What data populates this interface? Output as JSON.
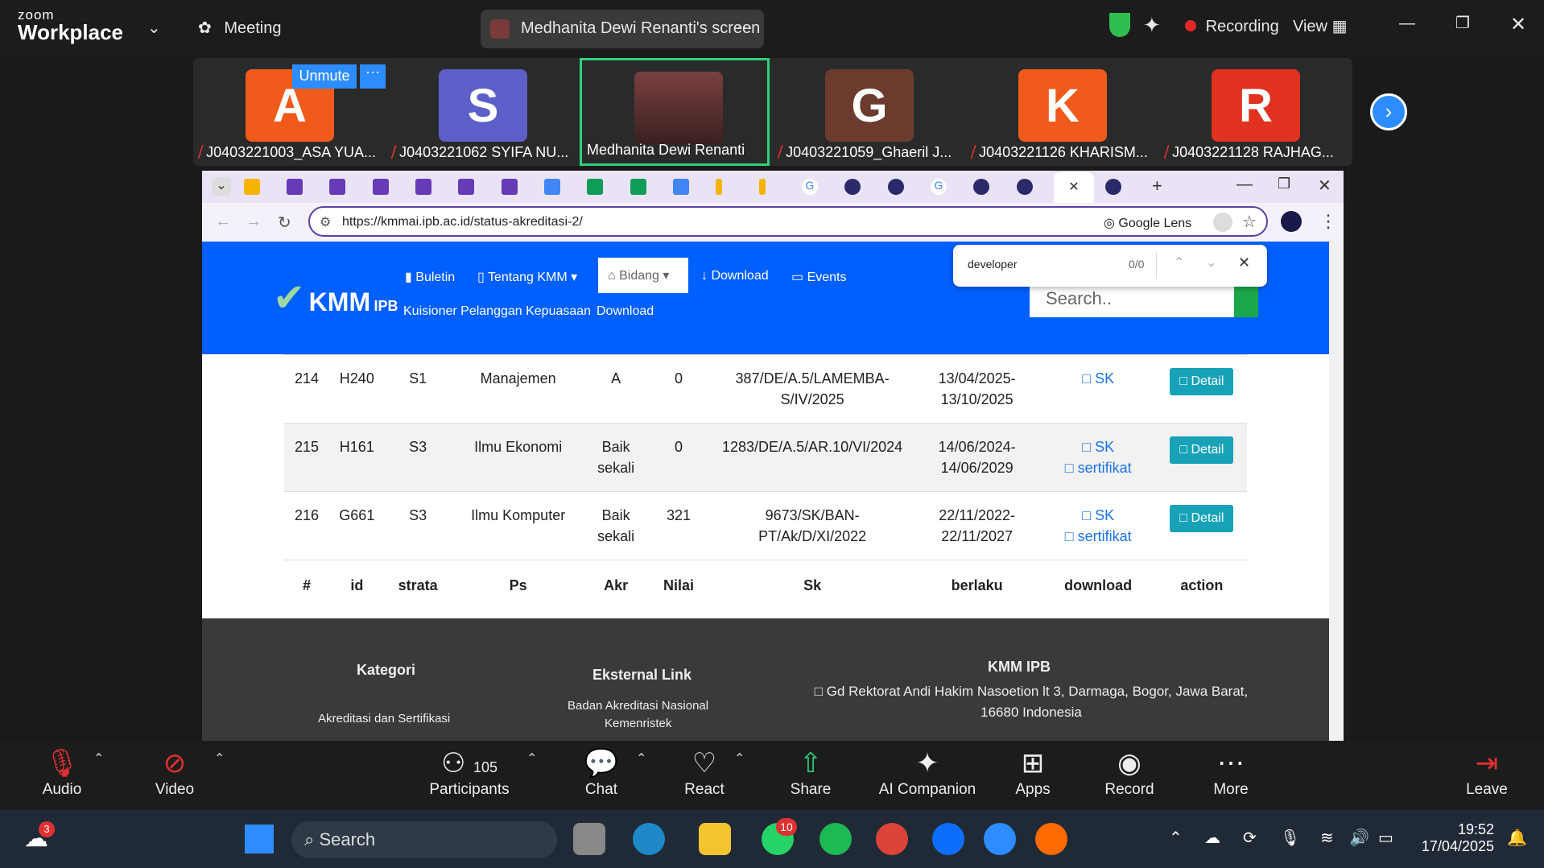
{
  "zoom": {
    "logo_small": "zoom",
    "logo_big": "Workplace",
    "meeting_label": "Meeting",
    "screen_share_label": "Medhanita Dewi Renanti's screen",
    "recording_label": "Recording",
    "view_label": "View",
    "unmute_label": "Unmute"
  },
  "participants": [
    {
      "initial": "A",
      "name": "J0403221003_ASA YUA...",
      "color": "#f05a1a"
    },
    {
      "initial": "S",
      "name": "J0403221062 SYIFA NU...",
      "color": "#5b5fc7"
    },
    {
      "initial": "",
      "name": "Medhanita Dewi Renanti",
      "color": "#6b3a3a"
    },
    {
      "initial": "G",
      "name": "J0403221059_Ghaeril J...",
      "color": "#6b3b2e"
    },
    {
      "initial": "K",
      "name": "J0403221126 KHARISM...",
      "color": "#f05a1a"
    },
    {
      "initial": "R",
      "name": "J0403221128 RAJHAG...",
      "color": "#e0321e"
    }
  ],
  "browser": {
    "url": "https://kmmai.ipb.ac.id/status-akreditasi-2/",
    "lens_label": "Google Lens",
    "find_query": "developer",
    "find_count": "0/0"
  },
  "site": {
    "logo_text": "KMM",
    "logo_sub": "IPB",
    "nav": [
      "Buletin",
      "Tentang KMM",
      "Bidang",
      "Download",
      "Events"
    ],
    "nav2": [
      "Kuisioner Pelanggan Kepuasaan",
      "Download"
    ],
    "search_placeholder": "Search.."
  },
  "table": {
    "headers": [
      "#",
      "id",
      "strata",
      "Ps",
      "Akr",
      "Nilai",
      "Sk",
      "berlaku",
      "download",
      "action"
    ],
    "rows": [
      {
        "no": "214",
        "id": "H240",
        "strata": "S1",
        "ps": "Manajemen",
        "akr": "A",
        "nilai": "0",
        "sk": "387/DE/A.5/LAMEMBA-S/IV/2025",
        "berlaku": "13/04/2025-13/10/2025",
        "dl1": "SK",
        "dl2": "",
        "action": "Detail"
      },
      {
        "no": "215",
        "id": "H161",
        "strata": "S3",
        "ps": "Ilmu Ekonomi",
        "akr": "Baik sekali",
        "nilai": "0",
        "sk": "1283/DE/A.5/AR.10/VI/2024",
        "berlaku": "14/06/2024-14/06/2029",
        "dl1": "SK",
        "dl2": "sertifikat",
        "action": "Detail"
      },
      {
        "no": "216",
        "id": "G661",
        "strata": "S3",
        "ps": "Ilmu Komputer",
        "akr": "Baik sekali",
        "nilai": "321",
        "sk": "9673/SK/BAN-PT/Ak/D/XI/2022",
        "berlaku": "22/11/2022-22/11/2027",
        "dl1": "SK",
        "dl2": "sertifikat",
        "action": "Detail"
      }
    ]
  },
  "footer": {
    "kategori_title": "Kategori",
    "kategori_item": "Akreditasi dan Sertifikasi",
    "eksternal_title": "Eksternal Link",
    "eksternal_item": "Badan Akreditasi Nasional",
    "eksternal_item2": "Kemenristek",
    "kmm_title": "KMM IPB",
    "kmm_address": "Gd Rektorat Andi Hakim Nasoetion lt 3, Darmaga, Bogor, Jawa Barat, 16680 Indonesia"
  },
  "controls": {
    "audio": "Audio",
    "video": "Video",
    "participants": "Participants",
    "participants_count": "105",
    "chat": "Chat",
    "react": "React",
    "share": "Share",
    "ai": "AI Companion",
    "apps": "Apps",
    "record": "Record",
    "more": "More",
    "leave": "Leave"
  },
  "taskbar": {
    "search": "Search",
    "time": "19:52",
    "date": "17/04/2025",
    "weather_badge": "3",
    "whatsapp_badge": "10"
  }
}
